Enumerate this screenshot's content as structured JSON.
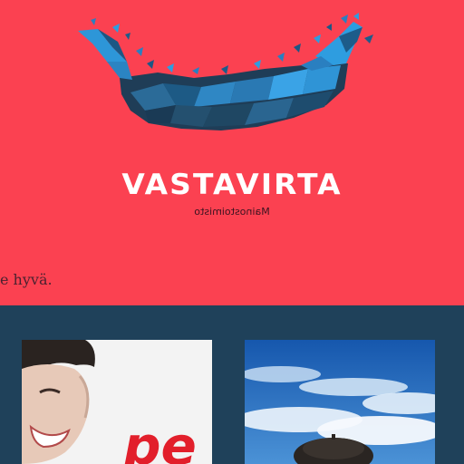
{
  "brand": {
    "name": "VASTAVIRTA",
    "tagline": "Mainostoimisto"
  },
  "ticker": {
    "text": "e hyvä."
  },
  "gallery": {
    "items": [
      {
        "id": "thumb-1",
        "overlay_text": "pe"
      },
      {
        "id": "thumb-2"
      }
    ]
  },
  "colors": {
    "hero_bg": "#fb4151",
    "gallery_bg": "#1f415a",
    "logo_dark": "#23475f",
    "logo_light": "#2e9fe0",
    "text_light": "#ffffff"
  }
}
